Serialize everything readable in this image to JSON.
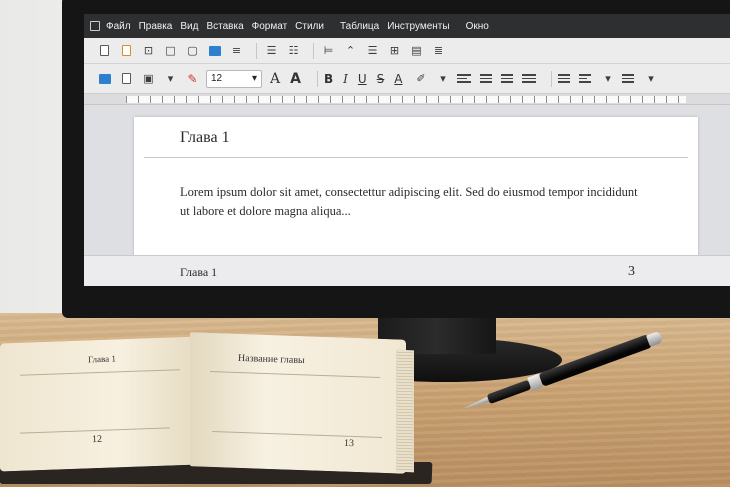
{
  "menu": {
    "items": [
      "Файл",
      "Правка",
      "Вид",
      "Вставка",
      "Формат",
      "Стили",
      "Таблица",
      "Инструменты",
      "Окно"
    ]
  },
  "toolbar": {
    "font_size": "12",
    "font_size_dropdown_icon": "chevron-down-icon",
    "grow_font": "A",
    "shrink_font": "A",
    "bold": "B",
    "italic": "I",
    "underline": "U",
    "strikethrough": "S",
    "font_color": "A"
  },
  "document": {
    "heading": "Глава 1",
    "body": "Lorem ipsum dolor sit amet, consectettur adipiscing elit. Sed do eiusmod tempor incididunt ut labore et dolore magna aliqua...",
    "footer_left": "Глава 1",
    "footer_page_number": "3"
  },
  "book": {
    "left_page_header": "Глава 1",
    "right_page_header": "Название главы",
    "left_page_number": "12",
    "right_page_number": "13"
  }
}
